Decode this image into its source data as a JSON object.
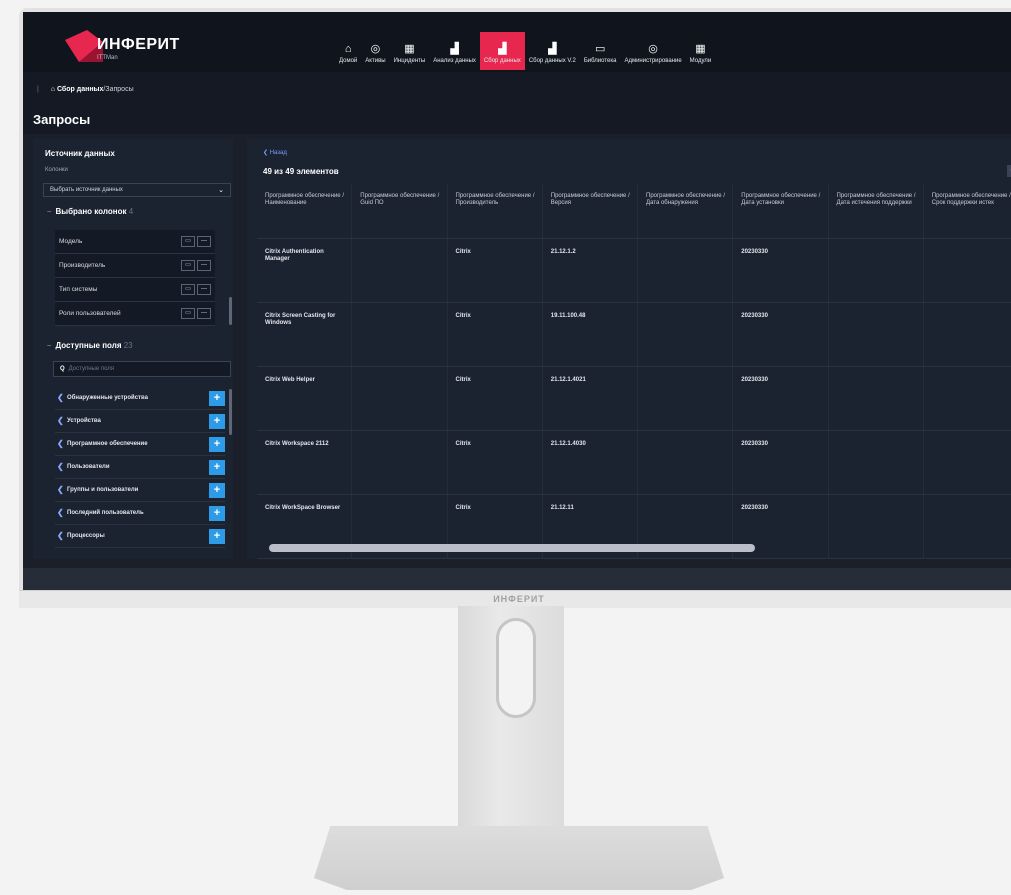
{
  "brand": {
    "name": "ИНФЕРИТ",
    "sub": "ITTMan",
    "chin_label": "ИНФЕРИТ",
    "accent": "#e8274f"
  },
  "nav": {
    "items": [
      {
        "label": "Домой",
        "icon": "home-icon",
        "glyph": "⌂"
      },
      {
        "label": "Активы",
        "icon": "assets-icon",
        "glyph": "◎"
      },
      {
        "label": "Инциденты",
        "icon": "grid-icon",
        "glyph": "▦"
      },
      {
        "label": "Анализ данных",
        "icon": "bar-chart-icon",
        "glyph": "▟"
      },
      {
        "label": "Сбор данных",
        "icon": "bar-chart-icon",
        "glyph": "▟",
        "active": true
      },
      {
        "label": "Сбор данных V.2",
        "icon": "bar-chart-icon",
        "glyph": "▟"
      },
      {
        "label": "Библиотека",
        "icon": "library-icon",
        "glyph": "▭"
      },
      {
        "label": "Администрирование",
        "icon": "settings-icon",
        "glyph": "◎"
      },
      {
        "label": "Модули",
        "icon": "grid-icon",
        "glyph": "▦"
      }
    ]
  },
  "breadcrumb": {
    "home": "Сбор данных",
    "separator": "/",
    "current": "Запросы"
  },
  "page": {
    "title": "Запросы"
  },
  "left": {
    "title": "Источник данных",
    "columns_label": "Колонки",
    "select_value": "Выбрать источник данных",
    "selected_section": "Выбрано колонок",
    "selected_count": "4",
    "selected_columns": [
      "Модель",
      "Производитель",
      "Тип системы",
      "Роли пользователей"
    ],
    "available_section": "Доступные поля",
    "available_count": "23",
    "search_placeholder": "Доступные поля",
    "fields": [
      "Обнаруженные устройства",
      "Устройства",
      "Программное обеспечение",
      "Пользователи",
      "Группы и пользователи",
      "Последний пользователь",
      "Процессоры"
    ]
  },
  "main": {
    "back_label": "Назад",
    "count_text": "49 из 49 элементов",
    "headers": [
      "Программное обеспечение / Наименование",
      "Программное обеспечение / Guid ПО",
      "Программное обеспечение / Производитель",
      "Программное обеспечение / Версия",
      "Программное обеспечение / Дата обнаружения",
      "Программное обеспечение / Дата установки",
      "Программное обеспечение / Дата истечения поддержки",
      "Программное обеспечение / Срок поддержки истек"
    ],
    "rows": [
      [
        "Citrix Authentication Manager",
        "",
        "Citrix",
        "21.12.1.2",
        "",
        "20230330",
        "",
        ""
      ],
      [
        "Citrix Screen Casting for Windows",
        "",
        "Citrix",
        "19.11.100.48",
        "",
        "20230330",
        "",
        ""
      ],
      [
        "Citrix Web Helper",
        "",
        "Citrix",
        "21.12.1.4021",
        "",
        "20230330",
        "",
        ""
      ],
      [
        "Citrix Workspace 2112",
        "",
        "Citrix",
        "21.12.1.4030",
        "",
        "20230330",
        "",
        ""
      ],
      [
        "Citrix WorkSpace Browser",
        "",
        "Citrix",
        "21.12.11",
        "",
        "20230330",
        "",
        ""
      ]
    ]
  }
}
